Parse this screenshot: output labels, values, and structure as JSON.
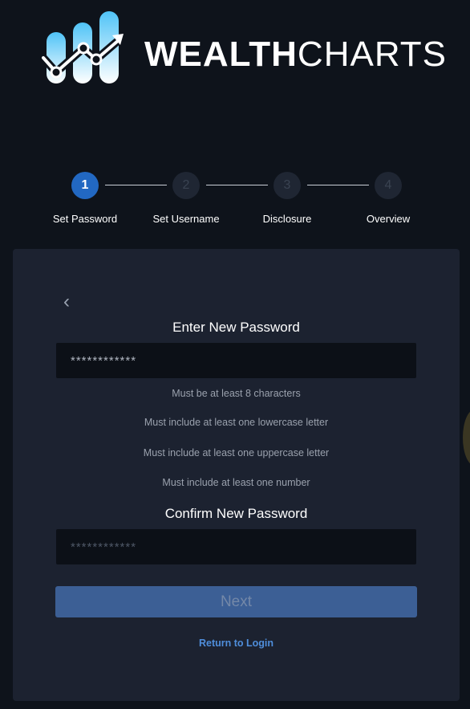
{
  "brand": {
    "wordmark_bold": "WEALTH",
    "wordmark_light": "CHARTS",
    "logo_icon": "bar-chart-trend-icon",
    "colors": {
      "accent": "#4fc3f7"
    }
  },
  "stepper": {
    "steps": [
      {
        "number": "1",
        "label": "Set Password",
        "active": true
      },
      {
        "number": "2",
        "label": "Set Username",
        "active": false
      },
      {
        "number": "3",
        "label": "Disclosure",
        "active": false
      },
      {
        "number": "4",
        "label": "Overview",
        "active": false
      }
    ],
    "colors": {
      "active": "#2268c2",
      "inactive": "#1f2633"
    }
  },
  "form": {
    "back_icon": "chevron-left-icon",
    "heading_new": "Enter New Password",
    "new_password_value": "************",
    "rules": [
      "Must be at least 8 characters",
      "Must include at least one lowercase letter",
      "Must include at least one uppercase letter",
      "Must include at least one number"
    ],
    "heading_confirm": "Confirm New Password",
    "confirm_password_placeholder": "************",
    "next_label": "Next",
    "return_link": "Return to Login",
    "colors": {
      "button": "#3c5f95",
      "link": "#4f8edb"
    }
  }
}
